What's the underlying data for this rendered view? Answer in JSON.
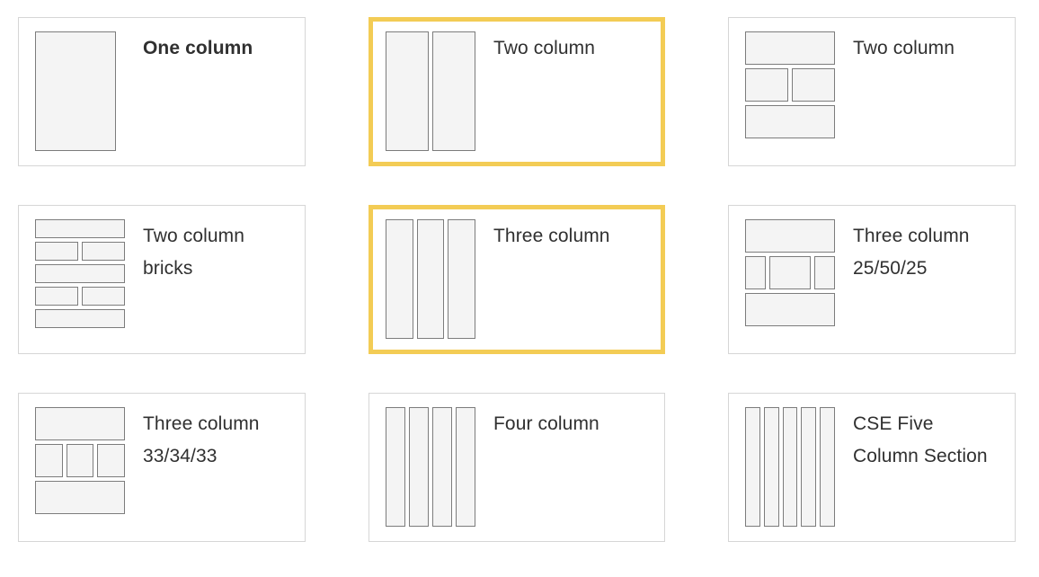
{
  "grid": {
    "columns": 3,
    "rows": 3,
    "selected_accent_color": "#f3cc55",
    "card_border_color": "#d6d6d6",
    "thumb_fill_color": "#f4f4f4",
    "thumb_stroke_color": "#7c7c7c",
    "label_color": "#303030"
  },
  "cards": [
    {
      "id": "one-column",
      "label": "One column",
      "thumb": "single",
      "selected": false,
      "bold": true
    },
    {
      "id": "two-column",
      "label": "Two column",
      "thumb": "columns-2",
      "selected": true,
      "bold": false
    },
    {
      "id": "two-column-sandwich",
      "label": "Two column",
      "thumb": "sandwich-2",
      "selected": false,
      "bold": false
    },
    {
      "id": "two-column-bricks",
      "label": "Two column bricks",
      "thumb": "bricks-2",
      "selected": false,
      "bold": false
    },
    {
      "id": "three-column",
      "label": "Three column",
      "thumb": "columns-3",
      "selected": true,
      "bold": false
    },
    {
      "id": "three-column-25-50-25",
      "label": "Three column 25/50/25",
      "thumb": "sandwich-25-50-25",
      "selected": false,
      "bold": false
    },
    {
      "id": "three-column-33-34-33",
      "label": "Three column 33/34/33",
      "thumb": "sandwich-33-34-33",
      "selected": false,
      "bold": false
    },
    {
      "id": "four-column",
      "label": "Four column",
      "thumb": "columns-4",
      "selected": false,
      "bold": false
    },
    {
      "id": "cse-five-column-section",
      "label": "CSE Five Column Section",
      "thumb": "columns-5",
      "selected": false,
      "bold": false
    }
  ]
}
